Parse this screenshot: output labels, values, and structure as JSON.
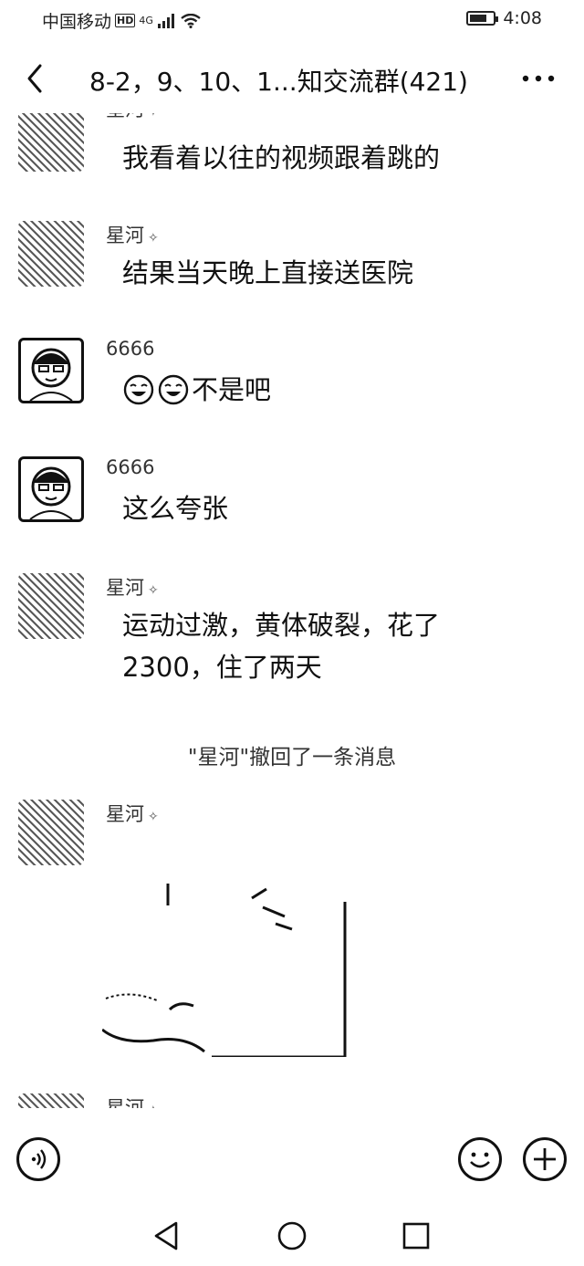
{
  "status_bar": {
    "carrier": "中国移动",
    "hd": "HD",
    "signal": "4G",
    "time": "4:08",
    "battery_level": 0.75
  },
  "header": {
    "title": "8-2，9、10、1...知交流群(421)",
    "back_icon": "chevron-left-icon",
    "more_icon": "more-horizontal-icon"
  },
  "messages": [
    {
      "sender": "星河",
      "text": "我看着以往的视频跟着跳的",
      "avatar": "noise"
    },
    {
      "sender": "星河",
      "text": "结果当天晚上直接送医院",
      "avatar": "noise"
    },
    {
      "sender": "6666",
      "text": "不是吧",
      "emojis": [
        "laugh-cry-emoji",
        "laugh-cry-emoji"
      ],
      "avatar": "face"
    },
    {
      "sender": "6666",
      "text": "这么夸张",
      "avatar": "face"
    },
    {
      "sender": "星河",
      "text": "运动过激，黄体破裂，花了2300，住了两天",
      "avatar": "noise"
    },
    {
      "sender": "星河",
      "text": "",
      "type": "image",
      "avatar": "noise"
    },
    {
      "sender": "星河",
      "text": "",
      "avatar": "noise"
    }
  ],
  "system_notice": "\"星河\"撤回了一条消息",
  "input_bar": {
    "voice_icon": "voice-icon",
    "emoji_icon": "smile-icon",
    "plus_icon": "plus-icon"
  },
  "nav_bar": {
    "back_icon": "nav-back-icon",
    "home_icon": "nav-home-icon",
    "recents_icon": "nav-recents-icon"
  }
}
